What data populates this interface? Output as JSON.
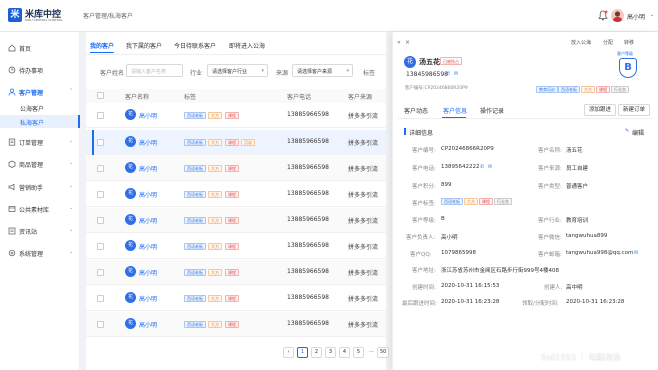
{
  "app": {
    "name": "米库中控",
    "subtitle": "MIKU CENTRAL CONTROL",
    "breadcrumb": "客户管理/私海客户"
  },
  "user": {
    "name": "高小明",
    "arrow": "⌄"
  },
  "sidebar": {
    "items": [
      {
        "label": "首页",
        "icon": "home-icon"
      },
      {
        "label": "待办事项",
        "icon": "todo-icon"
      },
      {
        "label": "客户管理",
        "icon": "customer-icon",
        "arrow": "⌃"
      },
      {
        "label": "订单管理",
        "icon": "order-icon",
        "arrow": "⌄"
      },
      {
        "label": "商品管理",
        "icon": "goods-icon",
        "arrow": "⌄"
      },
      {
        "label": "营销助手",
        "icon": "marketing-icon",
        "arrow": "⌄"
      },
      {
        "label": "公共素材库",
        "icon": "library-icon",
        "arrow": "⌄"
      },
      {
        "label": "资讯站",
        "icon": "news-icon",
        "arrow": "⌄"
      },
      {
        "label": "系统管理",
        "icon": "system-icon",
        "arrow": "⌄"
      }
    ],
    "subitems": [
      "公海客户",
      "私海客户"
    ]
  },
  "tabs": [
    "我的客户",
    "我下属的客户",
    "今日待联系客户",
    "即将进入公海"
  ],
  "filters": {
    "name_label": "客户姓名",
    "name_placeholder": "请输入客户名称",
    "industry_label": "行业",
    "industry_value": "请选择客户行业",
    "source_label": "来源",
    "source_value": "请选择客户来源",
    "tag_label": "标签"
  },
  "table": {
    "headers": [
      "客户名称",
      "标签",
      "客户电话",
      "客户来源"
    ],
    "rows": [
      {
        "avatar": "花",
        "name": "高小明",
        "tags": [
          "西语老板",
          "大方",
          "课程"
        ],
        "phone": "13885966598",
        "source": "拼多多引流"
      },
      {
        "avatar": "花",
        "name": "高小明",
        "tags": [
          "西语老板",
          "大方",
          "课程",
          "沉淀"
        ],
        "phone": "13885966598",
        "source": "拼多多引流"
      },
      {
        "avatar": "花",
        "name": "高小明",
        "tags": [
          "西语老板",
          "大方",
          "课程"
        ],
        "phone": "13885966598",
        "source": "拼多多引流"
      },
      {
        "avatar": "花",
        "name": "高小明",
        "tags": [
          "西语老板",
          "大方",
          "课程"
        ],
        "phone": "13885966598",
        "source": "拼多多引流"
      },
      {
        "avatar": "花",
        "name": "高小明",
        "tags": [
          "西语老板",
          "大方",
          "课程"
        ],
        "phone": "13885966598",
        "source": "拼多多引流"
      },
      {
        "avatar": "花",
        "name": "高小明",
        "tags": [
          "西语老板",
          "大方",
          "课程"
        ],
        "phone": "13885966598",
        "source": "拼多多引流"
      },
      {
        "avatar": "花",
        "name": "高小明",
        "tags": [
          "西语老板",
          "大方",
          "课程"
        ],
        "phone": "13885966598",
        "source": "拼多多引流"
      },
      {
        "avatar": "花",
        "name": "高小明",
        "tags": [
          "西语老板",
          "大方",
          "课程"
        ],
        "phone": "13885966598",
        "source": "拼多多引流"
      },
      {
        "avatar": "花",
        "name": "高小明",
        "tags": [
          "西语老板",
          "大方",
          "课程"
        ],
        "phone": "13885966598",
        "source": "拼多多引流"
      }
    ]
  },
  "pagination": {
    "prev": "‹",
    "pages": [
      "1",
      "2",
      "3",
      "4",
      "5",
      "...",
      "50"
    ],
    "next": "›"
  },
  "drawer": {
    "actions": [
      "放入公海",
      "分配",
      "转移"
    ],
    "close": "×",
    "customer": {
      "avatar": "花",
      "name": "汤五花",
      "status": "已被抢占",
      "phone": "13845986598",
      "code_label": "客户编号:CP20246866R20P9"
    },
    "grade": {
      "label": "客户等级",
      "value": "B"
    },
    "badges": [
      "教育培训",
      "西语老板",
      "大方",
      "课程",
      "行业务"
    ],
    "tabs": [
      "客户动态",
      "客户信息",
      "操作记录"
    ],
    "buttons": [
      "添加跟进",
      "新建订单"
    ],
    "section_title": "详细信息",
    "edit_label": "编辑",
    "fields_left": [
      {
        "label": "客户编号:",
        "value": "CP20246866R20P9"
      },
      {
        "label": "客户电话:",
        "value": "13895642222"
      },
      {
        "label": "客户积分:",
        "value": "899"
      },
      {
        "label": "客户标签:",
        "value": ""
      },
      {
        "label": "客户等级:",
        "value": "B"
      },
      {
        "label": "客户负责人:",
        "value": "高小明"
      },
      {
        "label": "客户QQ:",
        "value": "1079865998"
      },
      {
        "label": "客户地址:",
        "value": "浙江苏省苏州市金阊区石路步行街999号4楼408"
      },
      {
        "label": "创建时间:",
        "value": "2020-10-31 16:15:53"
      },
      {
        "label": "最后跟进时间:",
        "value": "2020-10-31 16:23:28"
      }
    ],
    "fields_right": [
      {
        "label": "客户名称:",
        "value": "汤五花"
      },
      {
        "label": "客户来源:",
        "value": "员工自建"
      },
      {
        "label": "客户类型:",
        "value": "普通客户"
      },
      {
        "label": "客户行业:",
        "value": "教育培训"
      },
      {
        "label": "客户微信:",
        "value": "tangwuhua899"
      },
      {
        "label": "客户邮箱:",
        "value": "tangwuhua998@qq.com"
      },
      {
        "label": "创建人:",
        "value": "高中明"
      },
      {
        "label": "领取/分配时间:",
        "value": "2020-10-31 16:23:28"
      }
    ],
    "tag_chips": [
      "西语老板",
      "大方",
      "课程",
      "行业务"
    ]
  },
  "watermark": "Sail1993 ｜ 站酷海洛"
}
